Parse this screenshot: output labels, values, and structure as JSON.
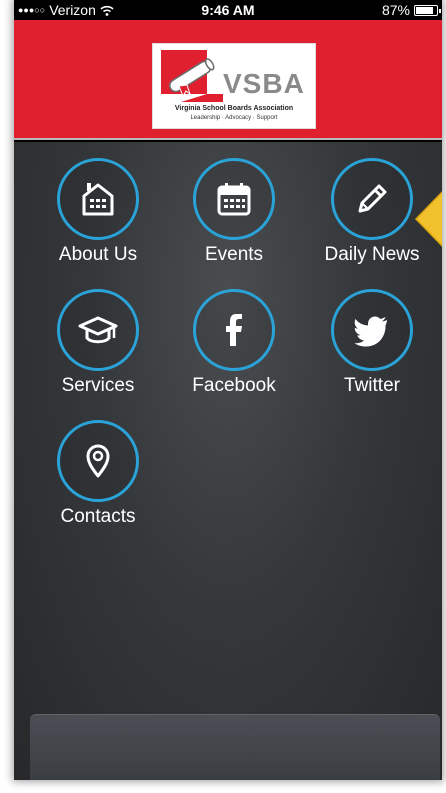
{
  "status_bar": {
    "signal": "●●●○○",
    "carrier": "Verizon",
    "time": "9:46 AM",
    "battery_percent": "87%",
    "battery_level": 0.87
  },
  "header": {
    "logo_word": "VSBA",
    "logo_subtitle": "Virginia School Boards Association",
    "logo_tagline": "Leadership · Advocacy · Support",
    "background_color": "#e0202e"
  },
  "menu": {
    "accent_color": "#2aa3d8",
    "items": [
      {
        "label": "About Us",
        "icon": "building-icon"
      },
      {
        "label": "Events",
        "icon": "calendar-icon"
      },
      {
        "label": "Daily News",
        "icon": "pencil-icon"
      },
      {
        "label": "Services",
        "icon": "graduation-cap-icon"
      },
      {
        "label": "Facebook",
        "icon": "facebook-icon"
      },
      {
        "label": "Twitter",
        "icon": "twitter-bird-icon"
      },
      {
        "label": "Contacts",
        "icon": "map-pin-icon"
      }
    ]
  }
}
